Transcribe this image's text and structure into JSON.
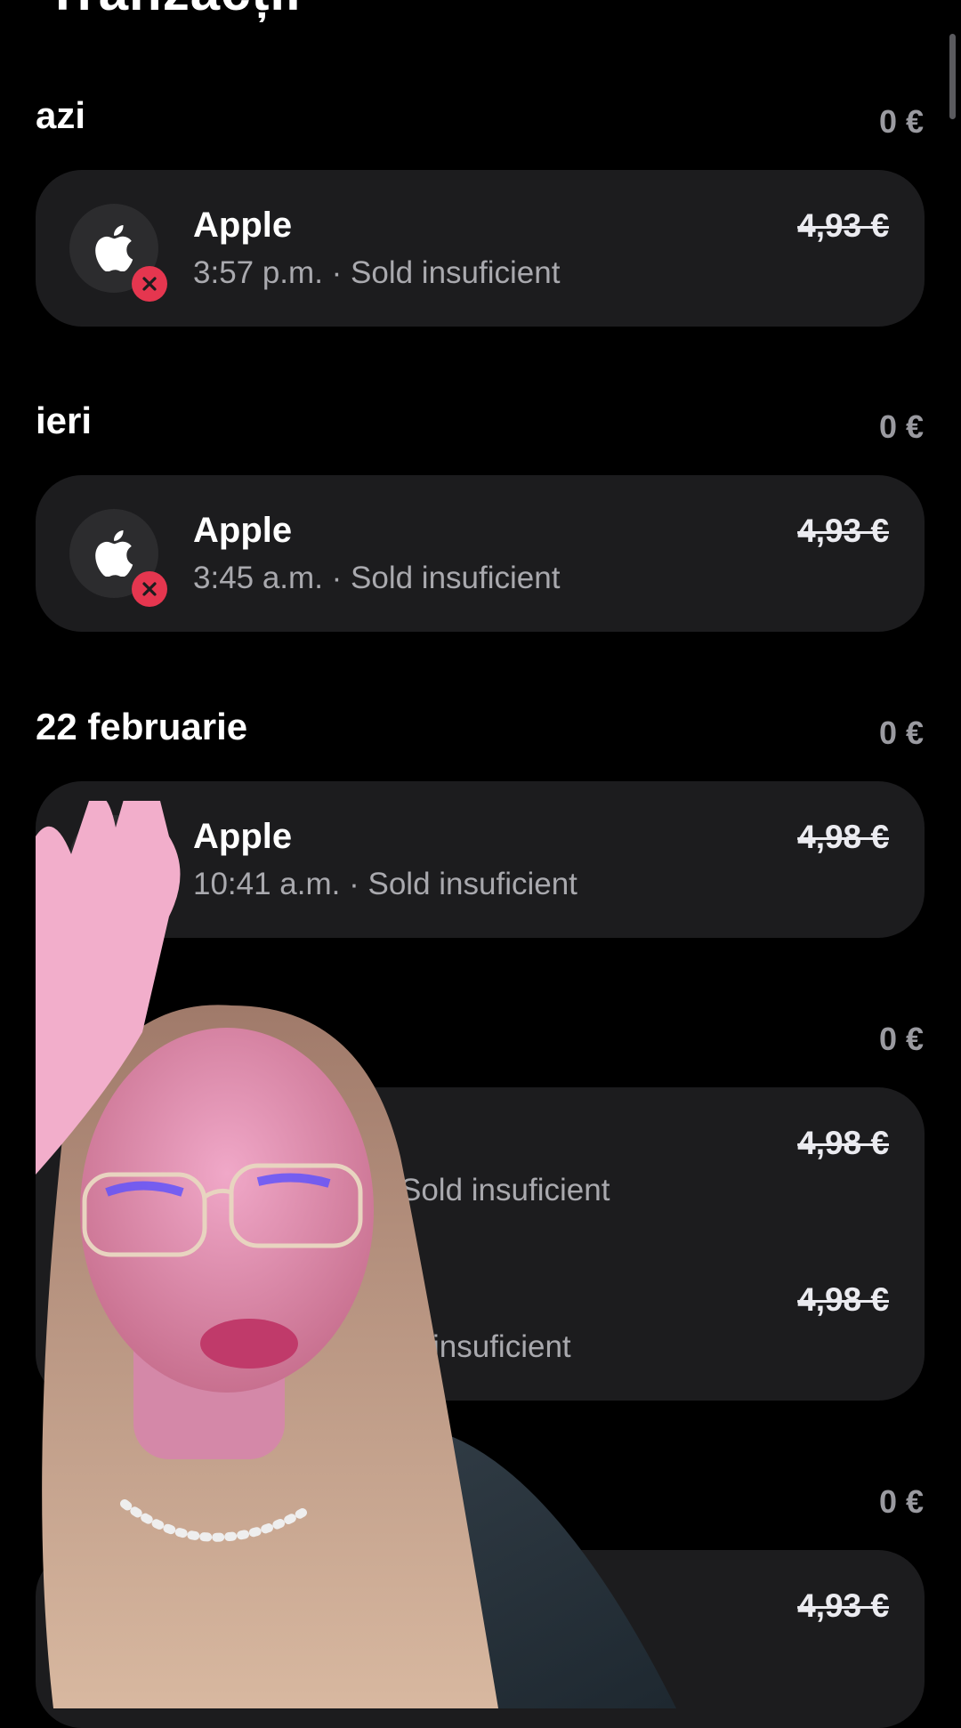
{
  "page": {
    "title": "Tranzacții"
  },
  "sections": [
    {
      "label": "azi",
      "total": "0 €",
      "transactions": [
        {
          "merchant": "Apple",
          "detail": "3:57 p.m. · Sold insuficient",
          "amount": "4,93 €"
        }
      ]
    },
    {
      "label": "ieri",
      "total": "0 €",
      "transactions": [
        {
          "merchant": "Apple",
          "detail": "3:45 a.m. · Sold insuficient",
          "amount": "4,93 €"
        }
      ]
    },
    {
      "label": "22 februarie",
      "total": "0 €",
      "transactions": [
        {
          "merchant": "Apple",
          "detail": "10:41 a.m. · Sold insuficient",
          "amount": "4,98 €"
        }
      ]
    },
    {
      "label": "",
      "total": "0 €",
      "transactions": [
        {
          "merchant": "",
          "detail": "Sold insuficient",
          "amount": "4,98 €"
        },
        {
          "merchant": "",
          "detail": "insuficient",
          "amount": "4,98 €"
        }
      ]
    },
    {
      "label": "",
      "total": "0 €",
      "transactions": [
        {
          "merchant": "",
          "detail": "",
          "amount": "4,93 €"
        }
      ]
    }
  ],
  "icons": {
    "merchant": "apple-logo-icon",
    "status": "declined-x-icon"
  },
  "colors": {
    "background": "#000000",
    "card": "#1c1c1e",
    "declined_badge": "#e5364f",
    "muted_text": "#a9a9ae"
  }
}
